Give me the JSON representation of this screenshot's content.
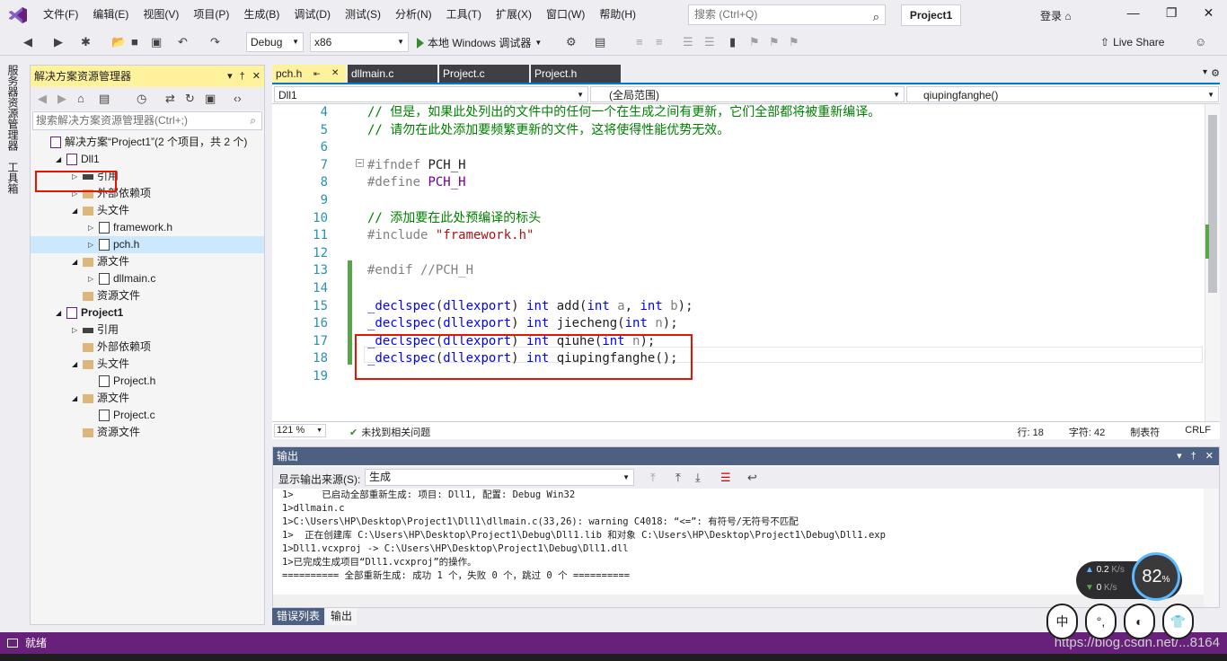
{
  "menubar": {
    "items": [
      "文件(F)",
      "编辑(E)",
      "视图(V)",
      "项目(P)",
      "生成(B)",
      "调试(D)",
      "测试(S)",
      "分析(N)",
      "工具(T)",
      "扩展(X)",
      "窗口(W)",
      "帮助(H)"
    ],
    "search_placeholder": "搜索 (Ctrl+Q)",
    "project_name": "Project1",
    "login": "登录"
  },
  "toolbar": {
    "config": "Debug",
    "platform": "x86",
    "run_label": "本地 Windows 调试器",
    "live_share": "Live Share"
  },
  "left_strip": {
    "server_explorer": "服务器资源管理器",
    "toolbox": "工具箱"
  },
  "solution_explorer": {
    "title": "解决方案资源管理器",
    "search_placeholder": "搜索解决方案资源管理器(Ctrl+;)",
    "tree": [
      {
        "label": "解决方案“Project1”(2 个项目，共 2 个)",
        "level": 0,
        "icon": "solution",
        "expander": "none"
      },
      {
        "label": "Dll1",
        "level": 1,
        "icon": "project",
        "expander": "expanded"
      },
      {
        "label": "引用",
        "level": 2,
        "icon": "references",
        "expander": "collapsed"
      },
      {
        "label": "外部依赖项",
        "level": 2,
        "icon": "folder",
        "expander": "collapsed"
      },
      {
        "label": "头文件",
        "level": 2,
        "icon": "folder",
        "expander": "expanded"
      },
      {
        "label": "framework.h",
        "level": 3,
        "icon": "file",
        "expander": "collapsed"
      },
      {
        "label": "pch.h",
        "level": 3,
        "icon": "file",
        "expander": "collapsed",
        "selected": true
      },
      {
        "label": "源文件",
        "level": 2,
        "icon": "folder",
        "expander": "expanded"
      },
      {
        "label": "dllmain.c",
        "level": 3,
        "icon": "file",
        "expander": "collapsed"
      },
      {
        "label": "资源文件",
        "level": 2,
        "icon": "folder",
        "expander": "none"
      },
      {
        "label": "Project1",
        "level": 1,
        "icon": "project",
        "expander": "expanded",
        "bold": true
      },
      {
        "label": "引用",
        "level": 2,
        "icon": "references",
        "expander": "collapsed"
      },
      {
        "label": "外部依赖项",
        "level": 2,
        "icon": "folder",
        "expander": "none"
      },
      {
        "label": "头文件",
        "level": 2,
        "icon": "folder",
        "expander": "expanded"
      },
      {
        "label": "Project.h",
        "level": 3,
        "icon": "file",
        "expander": "none"
      },
      {
        "label": "源文件",
        "level": 2,
        "icon": "folder",
        "expander": "expanded"
      },
      {
        "label": "Project.c",
        "level": 3,
        "icon": "file",
        "expander": "none"
      },
      {
        "label": "资源文件",
        "level": 2,
        "icon": "folder",
        "expander": "none"
      }
    ]
  },
  "editor": {
    "tabs": [
      {
        "label": "pch.h",
        "active": true
      },
      {
        "label": "dllmain.c",
        "active": false
      },
      {
        "label": "Project.c",
        "active": false
      },
      {
        "label": "Project.h",
        "active": false
      }
    ],
    "nav": {
      "project": "Dll1",
      "scope": "(全局范围)",
      "member": "qiupingfanghe()"
    },
    "line_numbers": [
      "4",
      "5",
      "6",
      "7",
      "8",
      "9",
      "10",
      "11",
      "12",
      "13",
      "14",
      "15",
      "16",
      "17",
      "18",
      "19"
    ],
    "zoom": "121 %",
    "issues": "未找到相关问题",
    "line_info": "行: 18",
    "col_info": "字符: 42",
    "indent": "制表符",
    "eol": "CRLF"
  },
  "output": {
    "title": "输出",
    "source_label": "显示输出来源(S):",
    "source_value": "生成",
    "lines": [
      "1>     已启动全部重新生成: 项目: Dll1, 配置: Debug Win32",
      "1>dllmain.c",
      "1>C:\\Users\\HP\\Desktop\\Project1\\Dll1\\dllmain.c(33,26): warning C4018: “<=”: 有符号/无符号不匹配",
      "1>  正在创建库 C:\\Users\\HP\\Desktop\\Project1\\Debug\\Dll1.lib 和对象 C:\\Users\\HP\\Desktop\\Project1\\Debug\\Dll1.exp",
      "1>Dll1.vcxproj -> C:\\Users\\HP\\Desktop\\Project1\\Debug\\Dll1.dll",
      "1>已完成生成项目“Dll1.vcxproj”的操作。",
      "========== 全部重新生成: 成功 1 个，失败 0 个，跳过 0 个 =========="
    ],
    "tabs": [
      "错误列表",
      "输出"
    ]
  },
  "statusbar": {
    "text": "就绪",
    "watermark": "https://blog.csdn.net/...8164"
  },
  "net_widget": {
    "up": "0.2",
    "down": "0",
    "unit": "K/s",
    "cpu_value": "82",
    "cpu_unit": "%"
  },
  "stickers": [
    "中",
    "°,",
    "◐",
    "👕"
  ]
}
